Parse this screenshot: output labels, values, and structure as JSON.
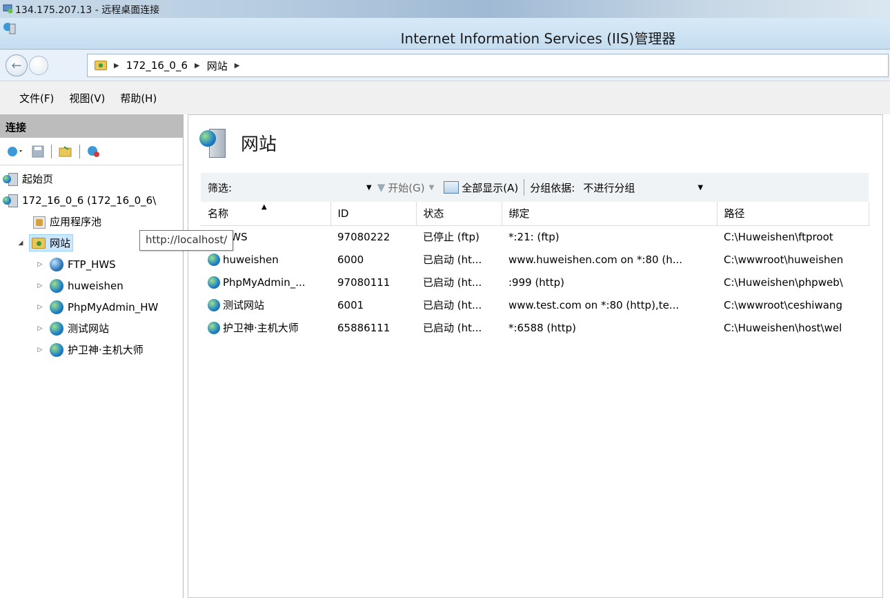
{
  "rdp": {
    "title": "134.175.207.13 - 远程桌面连接"
  },
  "window": {
    "title": "Internet Information Services (IIS)管理器"
  },
  "address": {
    "crumbs": [
      "172_16_0_6",
      "网站"
    ]
  },
  "menu": {
    "file": "文件(F)",
    "view": "视图(V)",
    "help": "帮助(H)"
  },
  "left": {
    "header": "连接",
    "tree": {
      "start_page": "起始页",
      "server": "172_16_0_6 (172_16_0_6\\",
      "app_pools": "应用程序池",
      "sites": "网站",
      "site_items": [
        "FTP_HWS",
        "huweishen",
        "PhpMyAdmin_HW",
        "测试网站",
        "护卫神·主机大师"
      ]
    }
  },
  "tooltip": {
    "text": "http://localhost/"
  },
  "main": {
    "title": "网站",
    "filter": {
      "label": "筛选:",
      "start": "开始(G)",
      "show_all": "全部显示(A)",
      "group_label": "分组依据:",
      "group_value": "不进行分组"
    },
    "columns": {
      "name": "名称",
      "id": "ID",
      "status": "状态",
      "binding": "绑定",
      "path": "路径"
    },
    "rows": [
      {
        "name": "HWS",
        "id": "97080222",
        "status": "已停止 (ftp)",
        "binding": "*:21: (ftp)",
        "path": "C:\\Huweishen\\ftproot",
        "icon": "ftp-globe-icon"
      },
      {
        "name": "huweishen",
        "id": "6000",
        "status": "已启动 (ht...",
        "binding": "www.huweishen.com on *:80 (h...",
        "path": "C:\\wwwroot\\huweishen",
        "icon": "globe-icon"
      },
      {
        "name": "PhpMyAdmin_...",
        "id": "97080111",
        "status": "已启动 (ht...",
        "binding": ":999 (http)",
        "path": "C:\\Huweishen\\phpweb\\",
        "icon": "globe-icon"
      },
      {
        "name": "测试网站",
        "id": "6001",
        "status": "已启动 (ht...",
        "binding": "www.test.com on *:80 (http),te...",
        "path": "C:\\wwwroot\\ceshiwang",
        "icon": "globe-icon"
      },
      {
        "name": "护卫神·主机大师",
        "id": "65886111",
        "status": "已启动 (ht...",
        "binding": "*:6588 (http)",
        "path": "C:\\Huweishen\\host\\wel",
        "icon": "globe-icon"
      }
    ]
  }
}
